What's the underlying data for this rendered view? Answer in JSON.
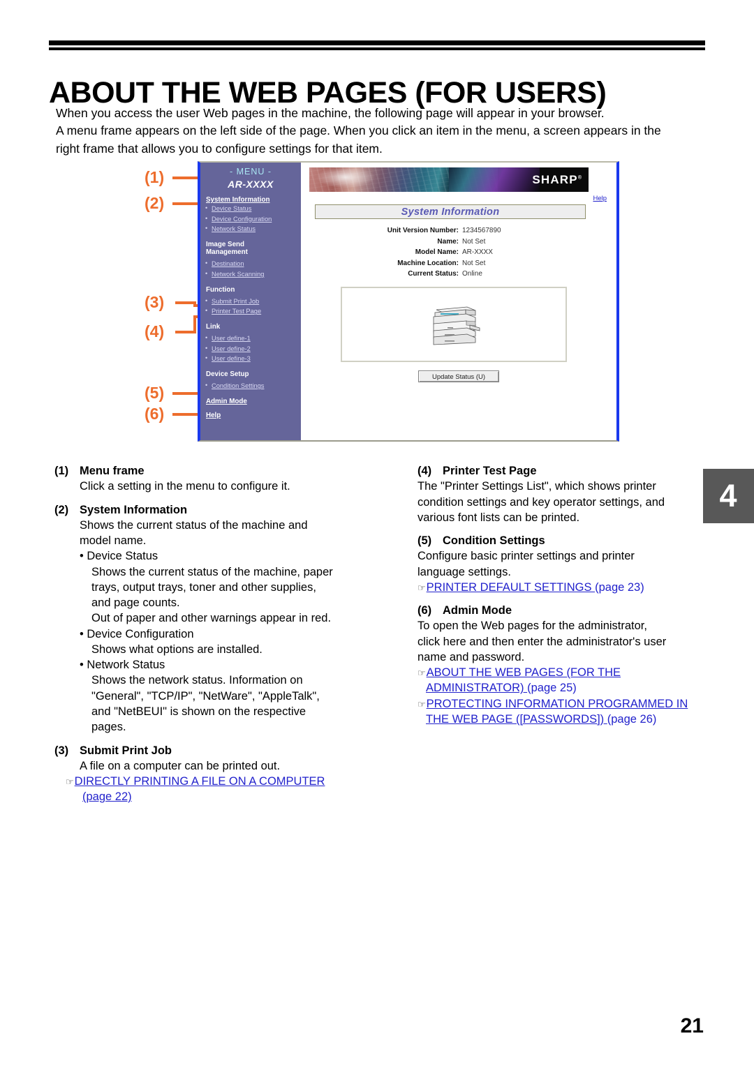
{
  "page": {
    "title": "ABOUT THE WEB PAGES (FOR USERS)",
    "intro_line1": "When you access the user Web pages in the machine, the following page will appear in your browser.",
    "intro_line2": "A menu frame appears on the left side of the page. When you click an item in the menu, a screen appears in the",
    "intro_line3": "right frame that allows you to configure settings for that item.",
    "chapter_tab": "4",
    "page_number": "21",
    "accent_color": "#ED6D2D",
    "link_color": "#2222CC",
    "menu_bg_color": "#65659A",
    "frame_border_color": "#1A39EE"
  },
  "callouts": [
    {
      "label": "(1)"
    },
    {
      "label": "(2)"
    },
    {
      "label": "(3)"
    },
    {
      "label": "(4)"
    },
    {
      "label": "(5)"
    },
    {
      "label": "(6)"
    }
  ],
  "screenshot": {
    "menu": {
      "title": "- MENU -",
      "model": "AR-XXXX",
      "groups": [
        {
          "head": "System Information",
          "head_is_link": true,
          "items": [
            "Device Status",
            "Device Configuration",
            "Network Status"
          ]
        },
        {
          "head": "Image Send",
          "head2": "Management",
          "head_is_link": false,
          "items": [
            "Destination",
            "Network Scanning"
          ]
        },
        {
          "head": "Function",
          "head_is_link": false,
          "items": [
            "Submit Print Job",
            "Printer Test Page"
          ]
        },
        {
          "head": "Link",
          "head_is_link": false,
          "items": [
            "User define-1",
            "User define-2",
            "User define-3"
          ]
        },
        {
          "head": "Device Setup",
          "head_is_link": false,
          "items": [
            "Condition Settings"
          ]
        }
      ],
      "admin_mode": "Admin Mode",
      "help": "Help"
    },
    "content": {
      "logo": "SHARP",
      "logo_mark": "®",
      "help_link": "Help",
      "panel_title": "System Information",
      "fields": [
        {
          "label": "Unit Version Number:",
          "value": "1234567890"
        },
        {
          "label": "Name:",
          "value": "Not Set"
        },
        {
          "label": "Model Name:",
          "value": "AR-XXXX"
        },
        {
          "label": "Machine Location:",
          "value": "Not Set"
        },
        {
          "label": "Current Status:",
          "value": "Online"
        }
      ],
      "update_button": "Update Status (U)"
    }
  },
  "descriptions": {
    "left": [
      {
        "num": "(1)",
        "title": "Menu frame",
        "lines": [
          "Click a setting in the menu to configure it."
        ]
      },
      {
        "num": "(2)",
        "title": "System Information",
        "lines": [
          "Shows the current status of the machine and",
          "model name."
        ],
        "bullets": [
          {
            "label": "Device Status",
            "lines": [
              "Shows the current status of the machine, paper",
              "trays, output trays, toner and other supplies,",
              "and page counts.",
              "Out of paper and other warnings appear in red."
            ]
          },
          {
            "label": "Device Configuration",
            "lines": [
              "Shows what options are installed."
            ]
          },
          {
            "label": "Network Status",
            "lines": [
              "Shows the network status. Information on",
              "\"General\", \"TCP/IP\", \"NetWare\", \"AppleTalk\",",
              "and \"NetBEUI\" is shown on the respective",
              "pages."
            ]
          }
        ]
      },
      {
        "num": "(3)",
        "title": "Submit Print Job",
        "lines": [
          "A file on a computer can be printed out."
        ],
        "refs": [
          {
            "text": "DIRECTLY PRINTING A FILE ON A COMPUTER ",
            "text2": "(page 22)"
          }
        ]
      }
    ],
    "right": [
      {
        "num": "(4)",
        "title": "Printer Test Page",
        "lines": [
          "The \"Printer Settings List\", which shows printer",
          "condition settings and key operator settings, and",
          "various font lists can be printed."
        ]
      },
      {
        "num": "(5)",
        "title": "Condition Settings",
        "lines": [
          "Configure basic printer settings and printer",
          "language settings."
        ],
        "refs": [
          {
            "text": "PRINTER DEFAULT SETTINGS ",
            "plain": "(page 23)"
          }
        ]
      },
      {
        "num": "(6)",
        "title": "Admin Mode",
        "lines": [
          "To open the Web pages for the administrator,",
          "click here and then enter the administrator's user",
          "name and password."
        ],
        "refs": [
          {
            "text": "ABOUT THE WEB PAGES (FOR THE ",
            "text2": "ADMINISTRATOR) ",
            "plain": "(page 25)"
          },
          {
            "text": "PROTECTING INFORMATION PROGRAMMED IN ",
            "text2": "THE WEB PAGE ([PASSWORDS]) ",
            "plain": "(page 26)"
          }
        ]
      }
    ]
  },
  "icons": {
    "hand_pointer": "☞",
    "printer": "printer-icon"
  }
}
